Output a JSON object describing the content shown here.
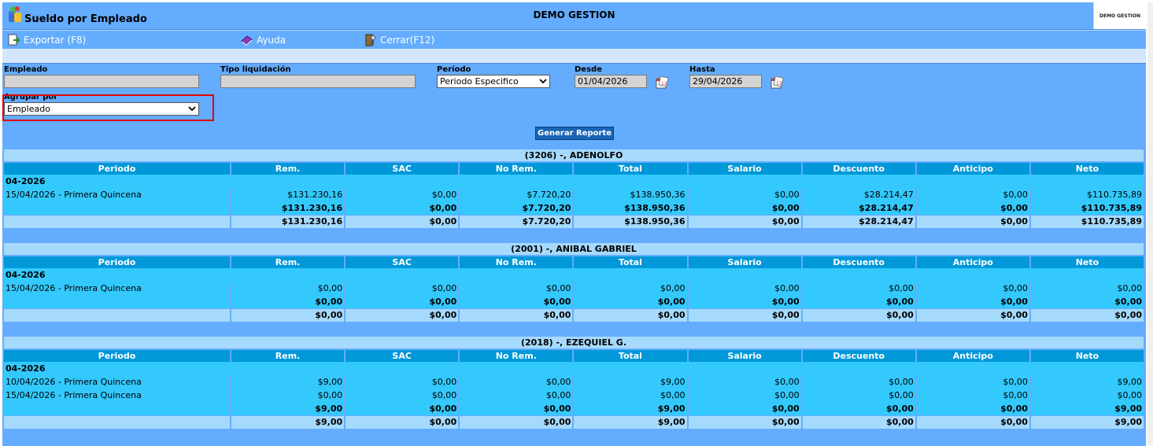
{
  "header": {
    "title": "Sueldo por Empleado",
    "company": "DEMO GESTION",
    "brand_box": "DEMO GESTION"
  },
  "toolbar": [
    {
      "label": "Exportar (F8)",
      "icon": "export-icon"
    },
    {
      "label": "Ayuda",
      "icon": "help-book-icon"
    },
    {
      "label": "Cerrar(F12)",
      "icon": "close-door-icon"
    }
  ],
  "filters": {
    "empleado_label": "Empleado",
    "empleado_value": "",
    "tipo_label": "Tipo liquidación",
    "tipo_value": "",
    "periodo_label": "Período",
    "periodo_value": "Periodo Especifico",
    "desde_label": "Desde",
    "desde_value": "01/04/2026",
    "hasta_label": "Hasta",
    "hasta_value": "29/04/2026",
    "agrupar_label": "Agrupar por",
    "agrupar_value": "Empleado",
    "generate_label": "Generar Reporte"
  },
  "columns": [
    "Periodo",
    "Rem.",
    "SAC",
    "No Rem.",
    "Total",
    "Salario",
    "Descuento",
    "Anticipo",
    "Neto"
  ],
  "groups": [
    {
      "title": "(3206) -, ADENOLFO",
      "month": "04-2026",
      "rows": [
        [
          "15/04/2026 - Primera Quincena",
          "$131.230,16",
          "$0,00",
          "$7.720,20",
          "$138.950,36",
          "$0,00",
          "$28.214,47",
          "$0,00",
          "$110.735,89"
        ]
      ],
      "subtotal": [
        "",
        "$131.230,16",
        "$0,00",
        "$7.720,20",
        "$138.950,36",
        "$0,00",
        "$28.214,47",
        "$0,00",
        "$110.735,89"
      ],
      "total": [
        "",
        "$131.230,16",
        "$0,00",
        "$7.720,20",
        "$138.950,36",
        "$0,00",
        "$28.214,47",
        "$0,00",
        "$110.735,89"
      ]
    },
    {
      "title": "(2001) -, ANIBAL GABRIEL",
      "month": "04-2026",
      "rows": [
        [
          "15/04/2026 - Primera Quincena",
          "$0,00",
          "$0,00",
          "$0,00",
          "$0,00",
          "$0,00",
          "$0,00",
          "$0,00",
          "$0,00"
        ]
      ],
      "subtotal": [
        "",
        "$0,00",
        "$0,00",
        "$0,00",
        "$0,00",
        "$0,00",
        "$0,00",
        "$0,00",
        "$0,00"
      ],
      "total": [
        "",
        "$0,00",
        "$0,00",
        "$0,00",
        "$0,00",
        "$0,00",
        "$0,00",
        "$0,00",
        "$0,00"
      ]
    },
    {
      "title": "(2018) -, EZEQUIEL G.",
      "month": "04-2026",
      "rows": [
        [
          "10/04/2026 - Primera Quincena",
          "$9,00",
          "$0,00",
          "$0,00",
          "$9,00",
          "$0,00",
          "$0,00",
          "$0,00",
          "$9,00"
        ],
        [
          "15/04/2026 - Primera Quincena",
          "$0,00",
          "$0,00",
          "$0,00",
          "$0,00",
          "$0,00",
          "$0,00",
          "$0,00",
          "$0,00"
        ]
      ],
      "subtotal": [
        "",
        "$9,00",
        "$0,00",
        "$0,00",
        "$9,00",
        "$0,00",
        "$0,00",
        "$0,00",
        "$9,00"
      ],
      "total": [
        "",
        "$9,00",
        "$0,00",
        "$0,00",
        "$9,00",
        "$0,00",
        "$0,00",
        "$0,00",
        "$9,00"
      ]
    }
  ]
}
